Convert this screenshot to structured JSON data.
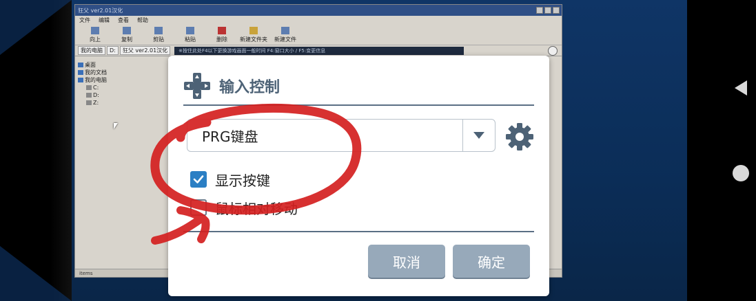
{
  "desktop": {
    "window_title": "狂父 ver2.01汉化",
    "menu": [
      "文件",
      "编辑",
      "查看",
      "帮助"
    ],
    "toolbar": [
      "向上",
      "复制",
      "剪贴",
      "粘贴",
      "删除",
      "新建文件夹",
      "新建文件"
    ],
    "address": [
      "我的电脑",
      "D:",
      "狂父 ver2.01汉化"
    ],
    "ticker": "※按住此处F4以下更换游戏画面一般时间  F4:窗口大小 / F5:变更信息",
    "tree": [
      "桌面",
      "我的文档",
      "我的电脑",
      "C:",
      "D:",
      "Z:"
    ],
    "status": "items"
  },
  "dialog": {
    "title": "输入控制",
    "select_value": "PRG键盘",
    "checkbox1_label": "显示按键",
    "checkbox1_checked": true,
    "checkbox2_label": "鼠标相对移动",
    "checkbox2_checked": false,
    "cancel_label": "取消",
    "ok_label": "确定"
  },
  "icons": {
    "title_icon": "dpad-icon",
    "settings": "gear-icon",
    "nav_back": "back-triangle-icon",
    "nav_home": "home-circle-icon"
  },
  "colors": {
    "accent": "#2b7fc4",
    "button": "#97a9ba",
    "title_text": "#4d6276",
    "annotation": "#d42020"
  }
}
